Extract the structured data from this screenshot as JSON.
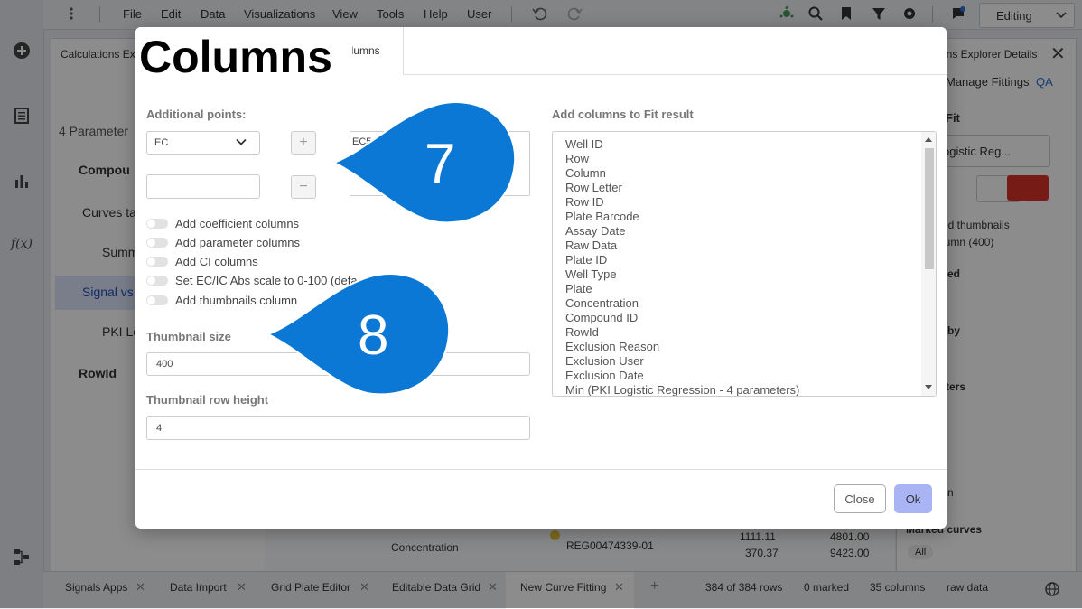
{
  "menu": {
    "items": [
      "File",
      "Edit",
      "Data",
      "Visualizations",
      "View",
      "Tools",
      "Help",
      "User"
    ],
    "mode": "Editing"
  },
  "left_panel": {
    "title": "Calculations Exp",
    "params_label": "4 Parameter",
    "tree": [
      {
        "label": "Compou"
      },
      {
        "label": "Curves ta"
      },
      {
        "label": "Summ"
      },
      {
        "label": "Signal vs"
      },
      {
        "label": "PKI Lo"
      },
      {
        "label": "RowId"
      }
    ]
  },
  "right_panel": {
    "title": "ons Explorer Details",
    "tab_manage": "Manage Fittings",
    "tab_qa": "QA",
    "fit_label": "Fit",
    "fit_select": "ogistic Reg...",
    "thumb_line1": "dd thumbnails",
    "thumb_line2": "lumn (400)",
    "ed": "ed",
    "by": "by",
    "ters": "ters",
    "n": "n",
    "marked_curves": "Marked curves",
    "all": "All"
  },
  "mid_panel": {
    "concentration": "Concentration",
    "rows": [
      {
        "id": "REG00474339-01",
        "v1": "1111.11",
        "v2": "4801.00"
      },
      {
        "id": "",
        "v1": "370.37",
        "v2": "9423.00"
      }
    ]
  },
  "bottom_bar": {
    "tabs": [
      "Signals Apps",
      "Data Import",
      "Grid Plate Editor",
      "Editable Data Grid",
      "New Curve Fitting"
    ],
    "rows_status": "384 of 384 rows",
    "marked_status": "0 marked",
    "columns_status": "35 columns",
    "raw": "raw data"
  },
  "dialog": {
    "title_overlay": "Columns",
    "active_tab": "olumns",
    "additional_points_label": "Additional points:",
    "point_select": "EC",
    "point_input_value": "",
    "point_list_item": "EC5",
    "plus_label": "+",
    "minus_label": "−",
    "toggles": [
      {
        "label": "Add coefficient columns",
        "on": false
      },
      {
        "label": "Add parameter columns",
        "on": false
      },
      {
        "label": "Add CI columns",
        "on": false
      },
      {
        "label": "Set EC/IC Abs scale to 0-100 (defa",
        "on": false
      },
      {
        "label": "Add thumbnails column",
        "on": false
      }
    ],
    "thumbnail_size_label": "Thumbnail size",
    "thumbnail_size_value": "400",
    "thumbnail_row_height_label": "Thumbnail row height",
    "thumbnail_row_height_value": "4",
    "add_columns_label": "Add columns to Fit result",
    "columns_list": [
      "Well ID",
      "Row",
      "Column",
      "Row Letter",
      "Row ID",
      "Plate Barcode",
      "Assay Date",
      "Raw Data",
      "Plate ID",
      "Well Type",
      "Plate",
      "Concentration",
      "Compound ID",
      "RowId",
      "Exclusion Reason",
      "Exclusion User",
      "Exclusion Date",
      "Min (PKI Logistic Regression - 4 parameters)"
    ],
    "close_label": "Close",
    "ok_label": "Ok"
  },
  "callouts": [
    {
      "number": "7"
    },
    {
      "number": "8"
    }
  ],
  "colors": {
    "callout": "#0b78d6",
    "ok_button": "#a9b4f4",
    "delete_button": "#d9322b"
  }
}
